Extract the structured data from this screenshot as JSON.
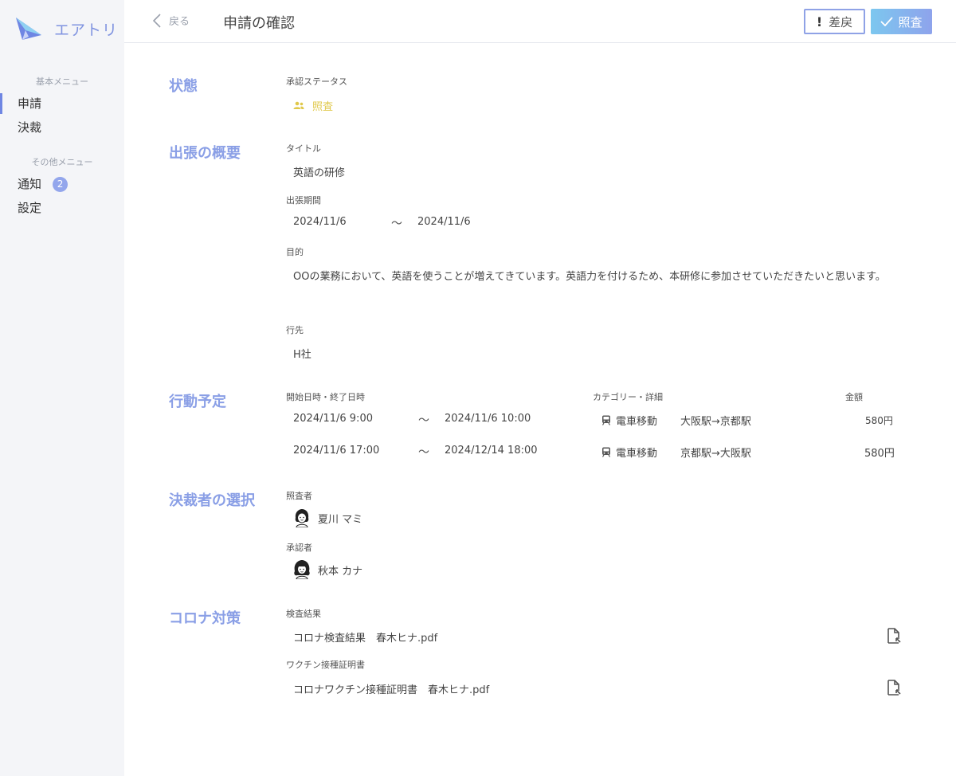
{
  "app": {
    "logo_text": "エアトリ"
  },
  "sidebar": {
    "section1": "基本メニュー",
    "section2": "その他メニュー",
    "items": [
      {
        "label": "申請",
        "active": true
      },
      {
        "label": "決裁"
      },
      {
        "label": "通知",
        "badge": "2"
      },
      {
        "label": "設定"
      }
    ]
  },
  "header": {
    "back_label": "戻る",
    "title": "申請の確認",
    "reject_label": "差戻",
    "approve_label": "照査"
  },
  "status_section": {
    "title": "状態",
    "label": "承認ステータス",
    "value": "照査",
    "color": "#e0c84a"
  },
  "overview": {
    "title": "出張の概要",
    "title_label": "タイトル",
    "title_value": "英語の研修",
    "period_label": "出張期間",
    "period_start": "2024/11/6",
    "period_sep": "〜",
    "period_end": "2024/11/6",
    "purpose_label": "目的",
    "purpose_value": "OOの業務において、英語を使うことが増えてきています。英語力を付けるため、本研修に参加させていただきたいと思います。",
    "destination_label": "行先",
    "destination_value": "H社"
  },
  "schedule": {
    "title": "行動予定",
    "col_datetime": "開始日時・終了日時",
    "col_category": "カテゴリー・詳細",
    "col_amount": "金額",
    "rows": [
      {
        "start": "2024/11/6 9:00",
        "sep": "〜",
        "end": "2024/11/6 10:00",
        "category": "電車移動",
        "detail": "大阪駅→京都駅",
        "amount": "580円"
      },
      {
        "start": "2024/11/6 17:00",
        "sep": "〜",
        "end": "2024/12/14 18:00",
        "category": "電車移動",
        "detail": "京都駅→大阪駅",
        "amount": "580円"
      }
    ]
  },
  "approvers": {
    "title": "決裁者の選択",
    "checker_label": "照査者",
    "checker_name": "夏川 マミ",
    "approver_label": "承認者",
    "approver_name": "秋本 カナ"
  },
  "covid": {
    "title": "コロナ対策",
    "test_label": "検査結果",
    "test_file": "コロナ検査結果　春木ヒナ.pdf",
    "vaccine_label": "ワクチン接種証明書",
    "vaccine_file": "コロナワクチン接種証明書　春木ヒナ.pdf"
  },
  "colors": {
    "accent": "#8a9fe6",
    "sidebar_bg": "#f4f5f8",
    "status": "#e0c84a"
  }
}
